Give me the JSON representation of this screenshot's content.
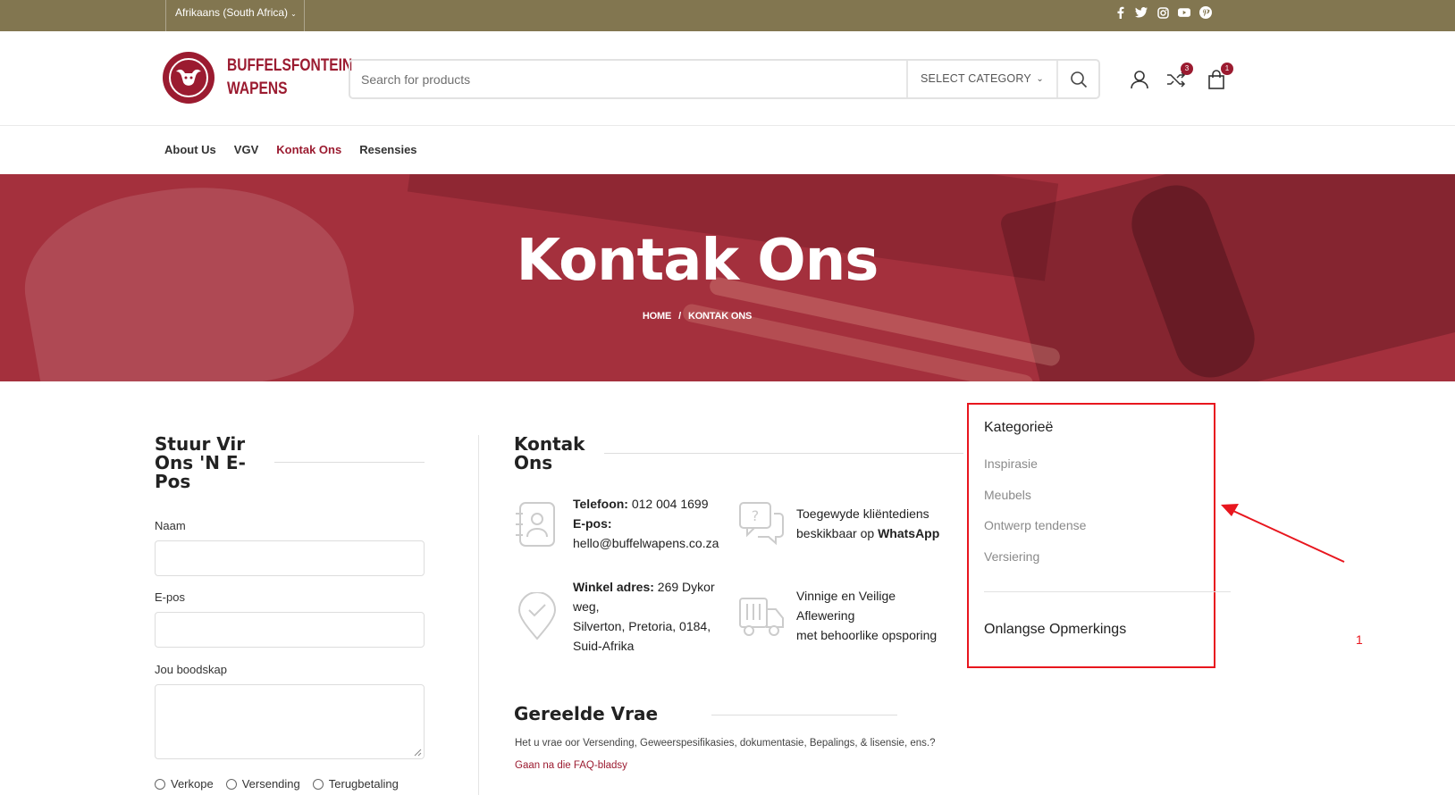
{
  "topbar": {
    "language": "Afrikaans (South Africa)",
    "social_icons": [
      "facebook-icon",
      "twitter-icon",
      "instagram-icon",
      "youtube-icon",
      "pinterest-icon"
    ]
  },
  "header": {
    "logo_line1": "BUFFELSFONTEIN",
    "logo_line2": "WAPENS",
    "search_placeholder": "Search for products",
    "category_label": "SELECT CATEGORY",
    "compare_count": "3",
    "cart_count": "1"
  },
  "nav": {
    "items": [
      {
        "label": "About Us"
      },
      {
        "label": "VGV"
      },
      {
        "label": "Kontak Ons"
      },
      {
        "label": "Resensies"
      }
    ],
    "active": "Kontak Ons"
  },
  "hero": {
    "title": "Kontak Ons",
    "breadcrumb_home": "HOME",
    "breadcrumb_sep": "/",
    "breadcrumb_current": "KONTAK ONS"
  },
  "form": {
    "title_line1": "Stuur Vir",
    "title_line2": "Ons 'N E-",
    "title_line3": "Pos",
    "name_label": "Naam",
    "email_label": "E-pos",
    "message_label": "Jou boodskap",
    "radio_options": [
      "Verkope",
      "Versending",
      "Terugbetaling"
    ]
  },
  "contact": {
    "title_line1": "Kontak",
    "title_line2": "Ons",
    "phone_label": "Telefoon:",
    "phone_value": "012 004 1699",
    "email_label": "E-pos:",
    "email_value": "hello@buffelwapens.co.za",
    "support_line1": "Toegewyde kliëntediens",
    "support_line2_prefix": "beskikbaar op",
    "support_whatsapp": "WhatsApp",
    "address_label": "Winkel adres:",
    "address_line1_value": "269 Dykor",
    "address_line2": "weg,",
    "address_line3": "Silverton, Pretoria, 0184,",
    "address_line4": "Suid-Afrika",
    "delivery_line1": "Vinnige en Veilige",
    "delivery_line2": "Aflewering",
    "delivery_line3": "met behoorlike opsporing"
  },
  "faq": {
    "title": "Gereelde Vrae",
    "text": "Het u vrae oor Versending, Geweerspesifikasies, dokumentasie, Bepalings, & lisensie, ens.?",
    "link": "Gaan na die FAQ-bladsy"
  },
  "sidebar": {
    "categories_title": "Kategorieë",
    "categories": [
      "Inspirasie",
      "Meubels",
      "Ontwerp tendense",
      "Versiering"
    ],
    "recent_title": "Onlangse Opmerkings"
  },
  "annotation": {
    "label": "1",
    "color": "#e8161e"
  },
  "colors": {
    "topbar": "#827650",
    "brand": "#9b1b30",
    "hero": "#a4303d"
  }
}
